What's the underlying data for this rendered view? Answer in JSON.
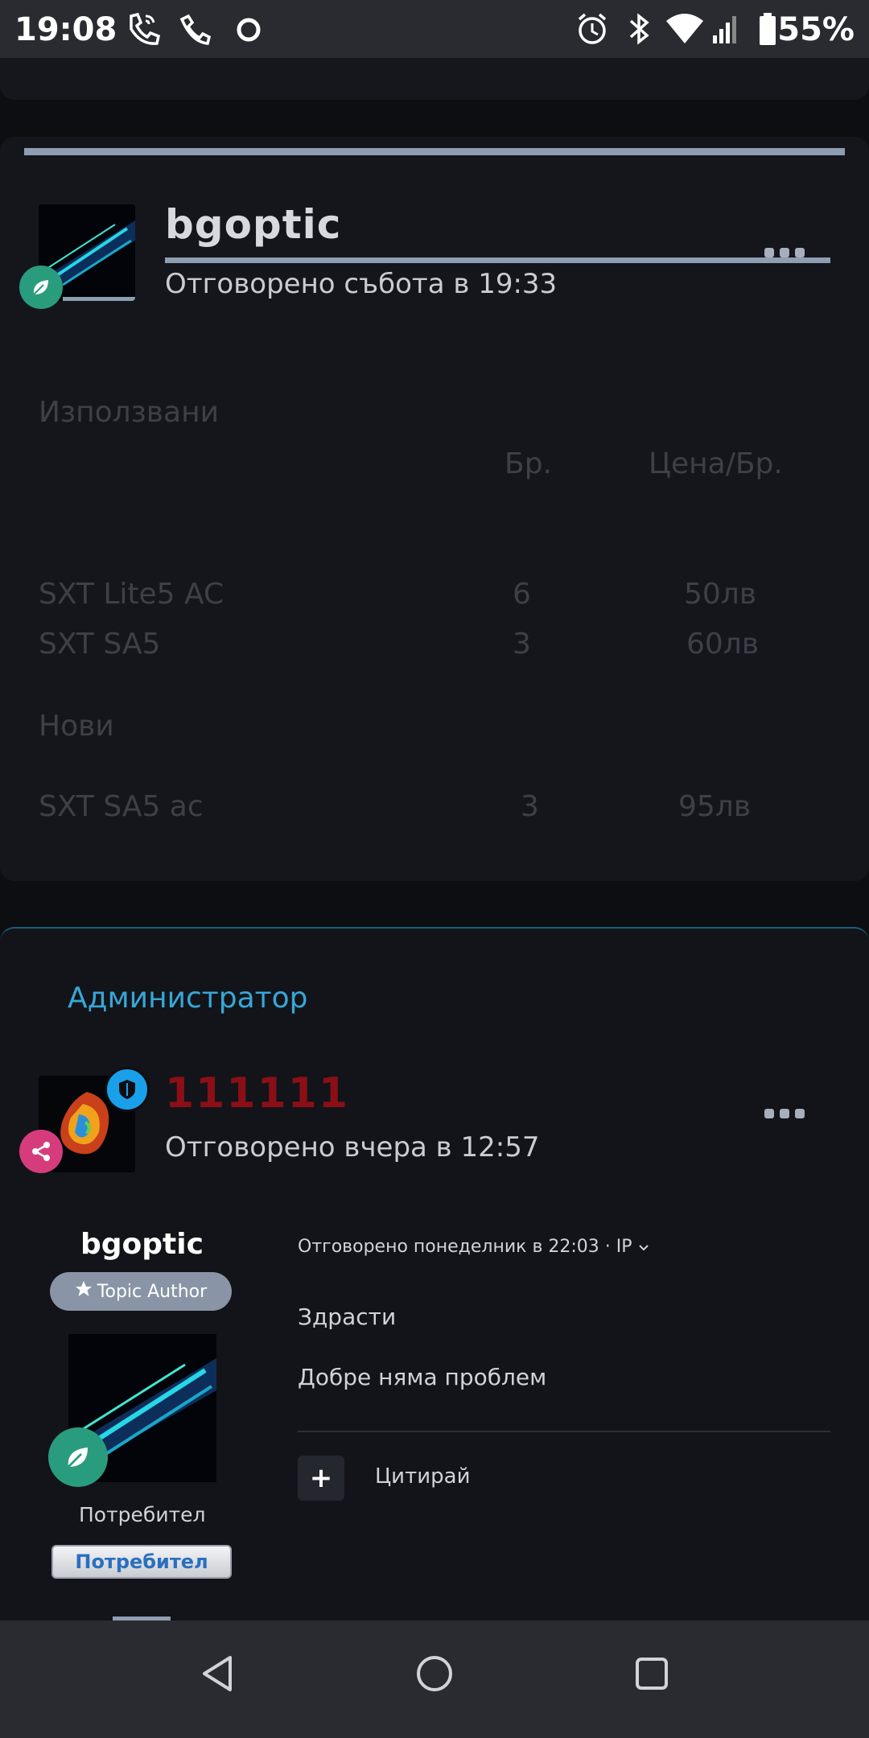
{
  "status_bar": {
    "time": "19:08",
    "battery_percent": "55%",
    "icons": [
      "wifi-call-icon",
      "wifi-call-2-icon",
      "circle-notification-icon",
      "alarm-icon",
      "bluetooth-icon",
      "wifi-icon",
      "signal-icon",
      "battery-icon"
    ]
  },
  "post1": {
    "username": "bgoptic",
    "replied": "Отговорено събота в 19:33",
    "table": {
      "section_used": "Използвани",
      "header_qty": "Бр.",
      "header_price": "Цена/Бр.",
      "rows_used": [
        {
          "name": "SXT Lite5 AC",
          "qty": "6",
          "price": "50лв"
        },
        {
          "name": "SXT SA5",
          "qty": "3",
          "price": "60лв"
        }
      ],
      "section_new": "Нови",
      "rows_new": [
        {
          "name": "SXT SA5 ac",
          "qty": "3",
          "price": "95лв"
        }
      ]
    }
  },
  "post2": {
    "role": "Администратор",
    "username": "111111",
    "replied": "Отговорено вчера в 12:57",
    "quote": {
      "username": "bgoptic",
      "badge": "Topic Author",
      "user_title": "Потребител",
      "user_button": "Потребител",
      "meta": "Отговорено понеделник в 22:03 · IP",
      "line1": "Здрасти",
      "line2": "Добре няма проблем",
      "plus": "+",
      "quote_label": "Цитирай"
    }
  },
  "colors": {
    "accent_blue": "#37a7d8",
    "admin_name": "#8b0f16",
    "badge_green": "#2a9c7e",
    "badge_pink": "#d63c7c",
    "shield_blue": "#1aa0ea"
  }
}
